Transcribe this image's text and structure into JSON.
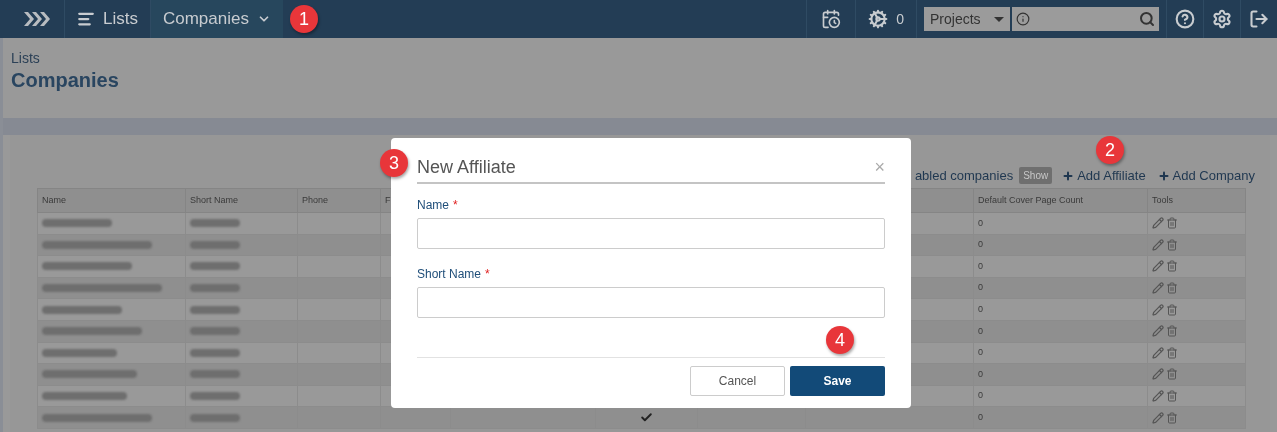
{
  "top_bar": {
    "breadcrumbs": [
      {
        "label": "Lists",
        "selected": false
      },
      {
        "label": "Companies",
        "selected": true
      }
    ],
    "jobs_count": "0",
    "project_select": {
      "value": "Projects"
    }
  },
  "page": {
    "parent_title": "Lists",
    "title": "Companies"
  },
  "toolbar": {
    "filter_text": "abled companies",
    "show_button": "Show",
    "actions": [
      "Add Affiliate",
      "Add Company"
    ]
  },
  "table": {
    "columns": [
      "Name",
      "Short Name",
      "Phone",
      "F",
      "Default Cover Page Count",
      "Tools"
    ],
    "rows": [
      {
        "cover_count": "0"
      },
      {
        "cover_count": "0"
      },
      {
        "cover_count": "0"
      },
      {
        "cover_count": "0"
      },
      {
        "cover_count": "0"
      },
      {
        "cover_count": "0"
      },
      {
        "cover_count": "0"
      },
      {
        "cover_count": "0"
      },
      {
        "cover_count": "0"
      },
      {
        "cover_count": "0",
        "checked": true
      }
    ]
  },
  "dialog": {
    "title": "New Affiliate",
    "close": "×",
    "required_mark": "*",
    "fields": [
      {
        "label": "Name",
        "required": true
      },
      {
        "label": "Short Name",
        "required": true
      }
    ],
    "buttons": [
      {
        "label": "Cancel",
        "kind": "secondary"
      },
      {
        "label": "Save",
        "kind": "primary"
      }
    ]
  },
  "callouts": [
    "1",
    "2",
    "3",
    "4"
  ]
}
